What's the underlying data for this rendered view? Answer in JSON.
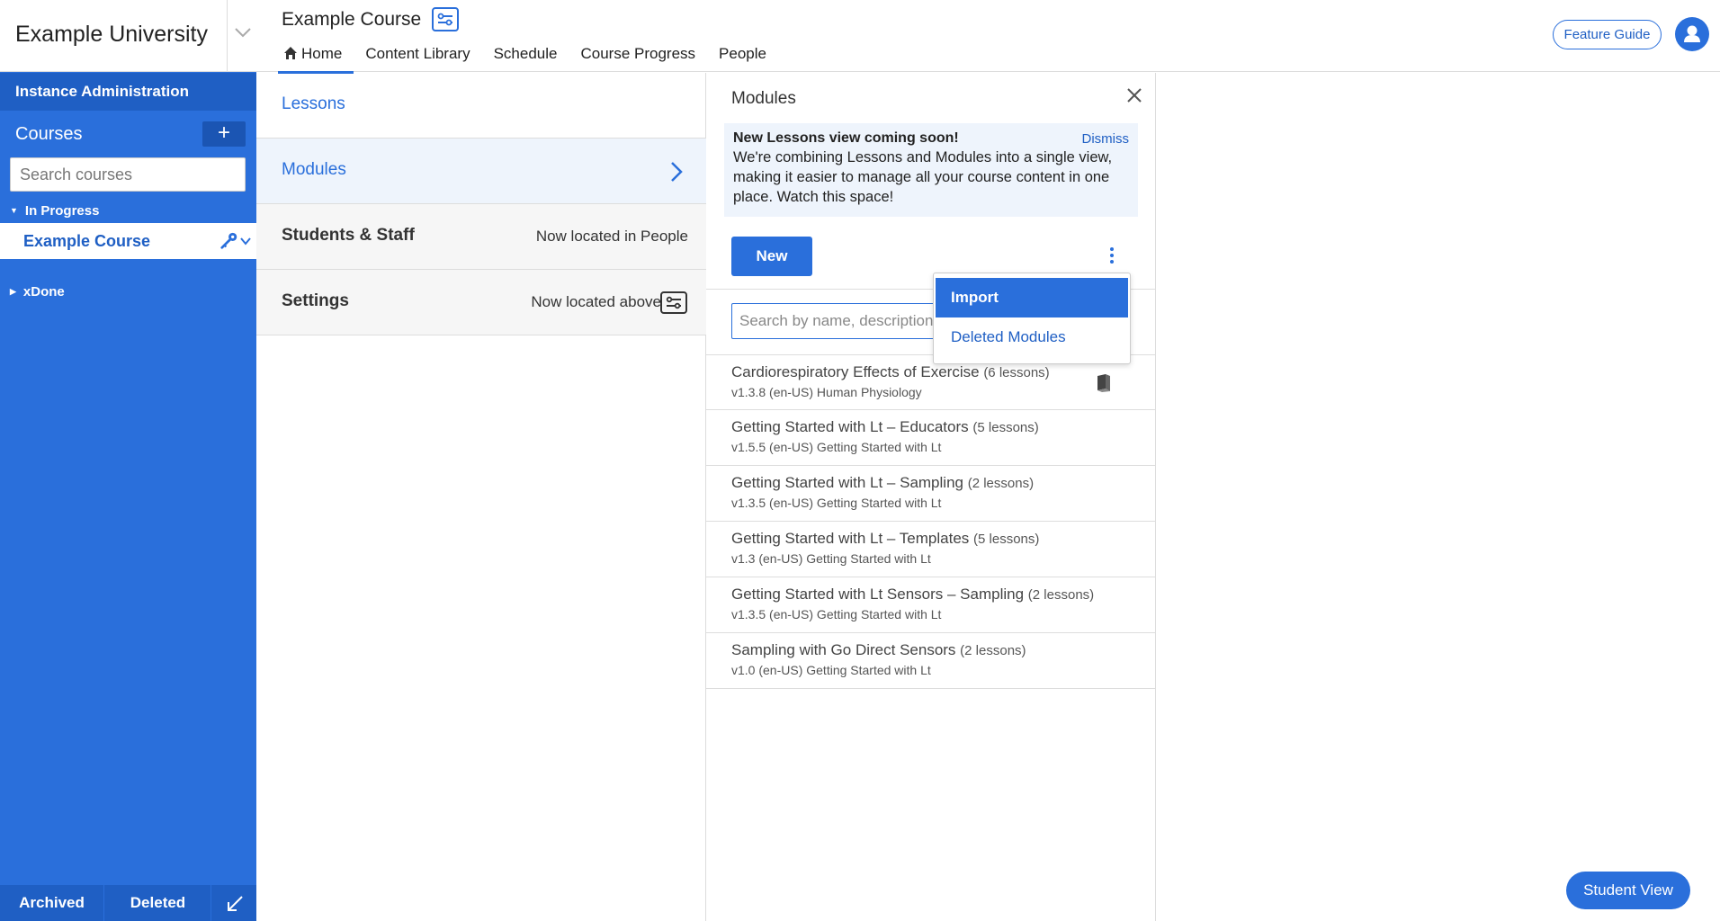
{
  "org": {
    "name": "Example University"
  },
  "sidebar": {
    "admin_link": "Instance Administration",
    "courses_label": "Courses",
    "add_course_symbol": "+",
    "search_placeholder": "Search courses",
    "groups": [
      {
        "label": "In Progress",
        "expanded": true,
        "items": [
          {
            "label": "Example Course",
            "selected": true
          }
        ]
      },
      {
        "label": "xDone",
        "expanded": false,
        "items": []
      }
    ],
    "footer": {
      "archived": "Archived",
      "deleted": "Deleted"
    }
  },
  "header": {
    "course_title": "Example Course",
    "tabs": [
      {
        "label": "Home",
        "active": true,
        "icon": "home-icon"
      },
      {
        "label": "Content Library"
      },
      {
        "label": "Schedule"
      },
      {
        "label": "Course Progress"
      },
      {
        "label": "People"
      }
    ],
    "feature_guide": "Feature Guide",
    "avatar_icon": "user-icon"
  },
  "settings_menu": {
    "rows": [
      {
        "label": "Lessons",
        "note": ""
      },
      {
        "label": "Modules",
        "note": ""
      },
      {
        "label": "Students & Staff",
        "note": "Now located in People"
      },
      {
        "label": "Settings",
        "note": "Now located above"
      }
    ]
  },
  "modules_panel": {
    "title": "Modules",
    "notice": {
      "title": "New Lessons view coming soon!",
      "body": "We're combining Lessons and Modules into a single view, making it easier to manage all your course content in one place. Watch this space!",
      "dismiss": "Dismiss"
    },
    "new_button": "New",
    "search_placeholder": "Search by name, description",
    "more_menu": [
      {
        "label": "Import",
        "highlighted": true
      },
      {
        "label": "Deleted Modules"
      }
    ],
    "modules": [
      {
        "name": "Cardiorespiratory Effects of Exercise",
        "count": "(6 lessons)",
        "meta": "v1.3.8 (en-US) Human Physiology",
        "icon": "book-icon"
      },
      {
        "name": "Getting Started with Lt – Educators",
        "count": "(5 lessons)",
        "meta": "v1.5.5 (en-US) Getting Started with Lt"
      },
      {
        "name": "Getting Started with Lt – Sampling",
        "count": "(2 lessons)",
        "meta": "v1.3.5 (en-US) Getting Started with Lt"
      },
      {
        "name": "Getting Started with Lt – Templates",
        "count": "(5 lessons)",
        "meta": "v1.3 (en-US) Getting Started with Lt"
      },
      {
        "name": "Getting Started with Lt Sensors – Sampling",
        "count": "(2 lessons)",
        "meta": "v1.3.5 (en-US) Getting Started with Lt"
      },
      {
        "name": "Sampling with Go Direct Sensors",
        "count": "(2 lessons)",
        "meta": "v1.0 (en-US) Getting Started with Lt"
      }
    ]
  },
  "student_view_button": "Student View",
  "colors": {
    "brand": "#2a6fdb",
    "brand_dark": "#1f5fc4",
    "notice_bg": "#eef4fc"
  }
}
